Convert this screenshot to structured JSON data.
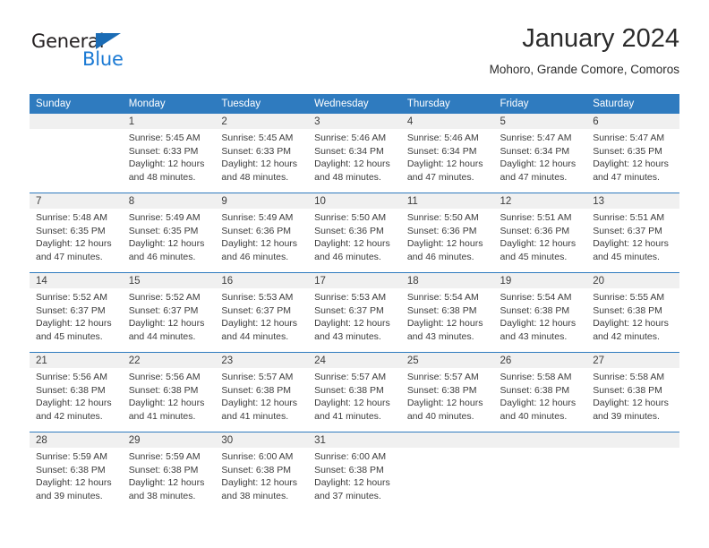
{
  "brand": {
    "name_top": "General",
    "name_bottom": "Blue",
    "accent_color": "#1b7ad4",
    "triangle_color": "#1b6cb5"
  },
  "header": {
    "title": "January 2024",
    "subtitle": "Mohoro, Grande Comore, Comoros"
  },
  "calendar": {
    "header_bg": "#2f7bbf",
    "daynum_bg": "#f0f0f0",
    "weekdays": [
      "Sunday",
      "Monday",
      "Tuesday",
      "Wednesday",
      "Thursday",
      "Friday",
      "Saturday"
    ],
    "weeks": [
      [
        {
          "day": "",
          "sunrise": "",
          "sunset": "",
          "daylight1": "",
          "daylight2": ""
        },
        {
          "day": "1",
          "sunrise": "Sunrise: 5:45 AM",
          "sunset": "Sunset: 6:33 PM",
          "daylight1": "Daylight: 12 hours",
          "daylight2": "and 48 minutes."
        },
        {
          "day": "2",
          "sunrise": "Sunrise: 5:45 AM",
          "sunset": "Sunset: 6:33 PM",
          "daylight1": "Daylight: 12 hours",
          "daylight2": "and 48 minutes."
        },
        {
          "day": "3",
          "sunrise": "Sunrise: 5:46 AM",
          "sunset": "Sunset: 6:34 PM",
          "daylight1": "Daylight: 12 hours",
          "daylight2": "and 48 minutes."
        },
        {
          "day": "4",
          "sunrise": "Sunrise: 5:46 AM",
          "sunset": "Sunset: 6:34 PM",
          "daylight1": "Daylight: 12 hours",
          "daylight2": "and 47 minutes."
        },
        {
          "day": "5",
          "sunrise": "Sunrise: 5:47 AM",
          "sunset": "Sunset: 6:34 PM",
          "daylight1": "Daylight: 12 hours",
          "daylight2": "and 47 minutes."
        },
        {
          "day": "6",
          "sunrise": "Sunrise: 5:47 AM",
          "sunset": "Sunset: 6:35 PM",
          "daylight1": "Daylight: 12 hours",
          "daylight2": "and 47 minutes."
        }
      ],
      [
        {
          "day": "7",
          "sunrise": "Sunrise: 5:48 AM",
          "sunset": "Sunset: 6:35 PM",
          "daylight1": "Daylight: 12 hours",
          "daylight2": "and 47 minutes."
        },
        {
          "day": "8",
          "sunrise": "Sunrise: 5:49 AM",
          "sunset": "Sunset: 6:35 PM",
          "daylight1": "Daylight: 12 hours",
          "daylight2": "and 46 minutes."
        },
        {
          "day": "9",
          "sunrise": "Sunrise: 5:49 AM",
          "sunset": "Sunset: 6:36 PM",
          "daylight1": "Daylight: 12 hours",
          "daylight2": "and 46 minutes."
        },
        {
          "day": "10",
          "sunrise": "Sunrise: 5:50 AM",
          "sunset": "Sunset: 6:36 PM",
          "daylight1": "Daylight: 12 hours",
          "daylight2": "and 46 minutes."
        },
        {
          "day": "11",
          "sunrise": "Sunrise: 5:50 AM",
          "sunset": "Sunset: 6:36 PM",
          "daylight1": "Daylight: 12 hours",
          "daylight2": "and 46 minutes."
        },
        {
          "day": "12",
          "sunrise": "Sunrise: 5:51 AM",
          "sunset": "Sunset: 6:36 PM",
          "daylight1": "Daylight: 12 hours",
          "daylight2": "and 45 minutes."
        },
        {
          "day": "13",
          "sunrise": "Sunrise: 5:51 AM",
          "sunset": "Sunset: 6:37 PM",
          "daylight1": "Daylight: 12 hours",
          "daylight2": "and 45 minutes."
        }
      ],
      [
        {
          "day": "14",
          "sunrise": "Sunrise: 5:52 AM",
          "sunset": "Sunset: 6:37 PM",
          "daylight1": "Daylight: 12 hours",
          "daylight2": "and 45 minutes."
        },
        {
          "day": "15",
          "sunrise": "Sunrise: 5:52 AM",
          "sunset": "Sunset: 6:37 PM",
          "daylight1": "Daylight: 12 hours",
          "daylight2": "and 44 minutes."
        },
        {
          "day": "16",
          "sunrise": "Sunrise: 5:53 AM",
          "sunset": "Sunset: 6:37 PM",
          "daylight1": "Daylight: 12 hours",
          "daylight2": "and 44 minutes."
        },
        {
          "day": "17",
          "sunrise": "Sunrise: 5:53 AM",
          "sunset": "Sunset: 6:37 PM",
          "daylight1": "Daylight: 12 hours",
          "daylight2": "and 43 minutes."
        },
        {
          "day": "18",
          "sunrise": "Sunrise: 5:54 AM",
          "sunset": "Sunset: 6:38 PM",
          "daylight1": "Daylight: 12 hours",
          "daylight2": "and 43 minutes."
        },
        {
          "day": "19",
          "sunrise": "Sunrise: 5:54 AM",
          "sunset": "Sunset: 6:38 PM",
          "daylight1": "Daylight: 12 hours",
          "daylight2": "and 43 minutes."
        },
        {
          "day": "20",
          "sunrise": "Sunrise: 5:55 AM",
          "sunset": "Sunset: 6:38 PM",
          "daylight1": "Daylight: 12 hours",
          "daylight2": "and 42 minutes."
        }
      ],
      [
        {
          "day": "21",
          "sunrise": "Sunrise: 5:56 AM",
          "sunset": "Sunset: 6:38 PM",
          "daylight1": "Daylight: 12 hours",
          "daylight2": "and 42 minutes."
        },
        {
          "day": "22",
          "sunrise": "Sunrise: 5:56 AM",
          "sunset": "Sunset: 6:38 PM",
          "daylight1": "Daylight: 12 hours",
          "daylight2": "and 41 minutes."
        },
        {
          "day": "23",
          "sunrise": "Sunrise: 5:57 AM",
          "sunset": "Sunset: 6:38 PM",
          "daylight1": "Daylight: 12 hours",
          "daylight2": "and 41 minutes."
        },
        {
          "day": "24",
          "sunrise": "Sunrise: 5:57 AM",
          "sunset": "Sunset: 6:38 PM",
          "daylight1": "Daylight: 12 hours",
          "daylight2": "and 41 minutes."
        },
        {
          "day": "25",
          "sunrise": "Sunrise: 5:57 AM",
          "sunset": "Sunset: 6:38 PM",
          "daylight1": "Daylight: 12 hours",
          "daylight2": "and 40 minutes."
        },
        {
          "day": "26",
          "sunrise": "Sunrise: 5:58 AM",
          "sunset": "Sunset: 6:38 PM",
          "daylight1": "Daylight: 12 hours",
          "daylight2": "and 40 minutes."
        },
        {
          "day": "27",
          "sunrise": "Sunrise: 5:58 AM",
          "sunset": "Sunset: 6:38 PM",
          "daylight1": "Daylight: 12 hours",
          "daylight2": "and 39 minutes."
        }
      ],
      [
        {
          "day": "28",
          "sunrise": "Sunrise: 5:59 AM",
          "sunset": "Sunset: 6:38 PM",
          "daylight1": "Daylight: 12 hours",
          "daylight2": "and 39 minutes."
        },
        {
          "day": "29",
          "sunrise": "Sunrise: 5:59 AM",
          "sunset": "Sunset: 6:38 PM",
          "daylight1": "Daylight: 12 hours",
          "daylight2": "and 38 minutes."
        },
        {
          "day": "30",
          "sunrise": "Sunrise: 6:00 AM",
          "sunset": "Sunset: 6:38 PM",
          "daylight1": "Daylight: 12 hours",
          "daylight2": "and 38 minutes."
        },
        {
          "day": "31",
          "sunrise": "Sunrise: 6:00 AM",
          "sunset": "Sunset: 6:38 PM",
          "daylight1": "Daylight: 12 hours",
          "daylight2": "and 37 minutes."
        },
        {
          "day": "",
          "sunrise": "",
          "sunset": "",
          "daylight1": "",
          "daylight2": ""
        },
        {
          "day": "",
          "sunrise": "",
          "sunset": "",
          "daylight1": "",
          "daylight2": ""
        },
        {
          "day": "",
          "sunrise": "",
          "sunset": "",
          "daylight1": "",
          "daylight2": ""
        }
      ]
    ]
  }
}
